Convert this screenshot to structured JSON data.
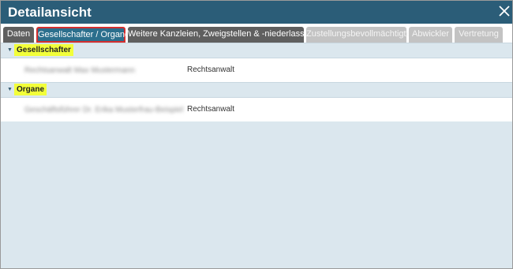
{
  "dialog": {
    "title": "Detailansicht",
    "close_icon": "close-icon"
  },
  "tabs": [
    {
      "label": "Daten",
      "state": "default"
    },
    {
      "label": "Gesellschafter / Organe",
      "state": "active"
    },
    {
      "label": "Weitere Kanzleien, Zweigstellen & -niederlassungen",
      "state": "default"
    },
    {
      "label": "Zustellungsbevollmächtigte",
      "state": "disabled"
    },
    {
      "label": "Abwickler",
      "state": "disabled"
    },
    {
      "label": "Vertretung",
      "state": "disabled"
    }
  ],
  "groups": [
    {
      "label": "Gesellschafter",
      "rows": [
        {
          "name": "Rechtsanwalt Max Mustermann",
          "role": "Rechtsanwalt"
        }
      ]
    },
    {
      "label": "Organe",
      "rows": [
        {
          "name": "Geschäftsführer Dr. Erika Musterfrau-Beispiel",
          "role": "Rechtsanwalt"
        }
      ]
    }
  ],
  "colors": {
    "titlebar": "#2b5d78",
    "active_tab": "#2b6f8d",
    "active_tab_border": "#d32f2f",
    "dark_tab": "#5f5f5f",
    "disabled_tab": "#c3c3c3",
    "panel_background": "#dbe7ee",
    "group_label_highlight": "#f2ff3a"
  }
}
